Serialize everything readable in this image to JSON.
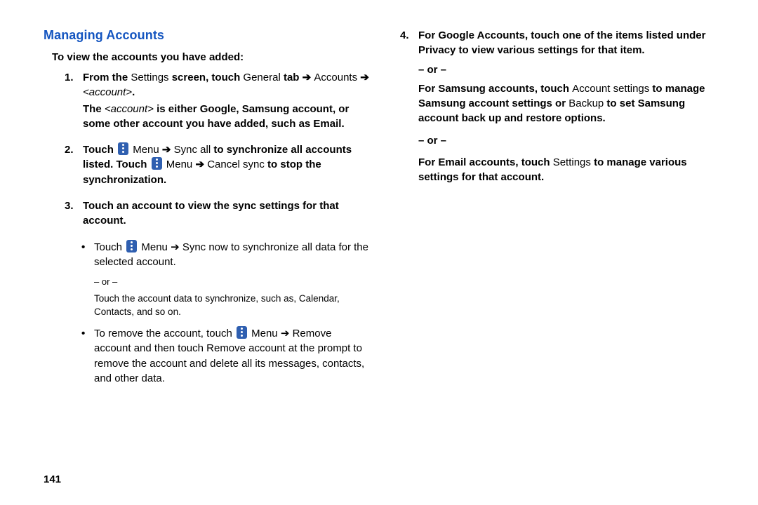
{
  "heading": "Managing Accounts",
  "subhead": "To view the accounts you have added:",
  "left": {
    "step1_num": "1.",
    "step1_a": "From the ",
    "step1_settings": "Settings",
    "step1_b": " screen, touch ",
    "step1_general": "General",
    "step1_c": " tab ",
    "step1_arrow": "➔",
    "step1_accounts": "Accounts",
    "step1_arrow2": "➔",
    "step1_acctital": "<account>",
    "step1_d": ".",
    "step1_line2a": "The ",
    "step1_line2acc": "<account>",
    "step1_line2b": " is either Google, Samsung account, or some other account you have added, such as Email.",
    "step2_num": "2.",
    "step2_a": "Touch ",
    "step2_menu": "Menu",
    "step2_arrow": "➔",
    "step2_syncall": "Sync all",
    "step2_b": " to synchronize all accounts listed. Touch ",
    "step2_menu2": "Menu",
    "step2_arrow2": "➔",
    "step2_cancel": "Cancel sync",
    "step2_c": " to stop the synchronization.",
    "step3_num": "3.",
    "step3_a": "Touch an account to view the sync settings for that account.",
    "bullet1_a": "Touch ",
    "bullet1_menu": "Menu",
    "bullet1_arrow": "➔",
    "bullet1_syncnow": "Sync now",
    "bullet1_b": " to synchronize all data for the selected account.",
    "or": "– or –",
    "sub_detail": "Touch the account data to synchronize, such as, Calendar, Contacts, and so on.",
    "bullet2_a": "To remove the account, touch ",
    "bullet2_menu": "Menu",
    "bullet2_arrow": "➔",
    "bullet2_remove": "Remove account",
    "bullet2_b": " and then touch ",
    "bullet2_remove2": "Remove account",
    "bullet2_c": " at the prompt to remove the account and delete all its messages, contacts, and other data."
  },
  "right": {
    "step4_num": "4.",
    "s4_a": "For Google Accounts, touch one of the items listed under Privacy to view various settings for that item.",
    "or": "– or –",
    "s4_b1": "For Samsung accounts, touch ",
    "s4_acctset": "Account settings",
    "s4_b2": " to manage Samsung account settings or ",
    "s4_backup": "Backup",
    "s4_b3": " to set Samsung account back up and restore options.",
    "or2": "– or –",
    "s4_c1": "For Email accounts, touch ",
    "s4_settings": "Settings",
    "s4_c2": " to manage various settings for that account."
  },
  "page_number": "141"
}
